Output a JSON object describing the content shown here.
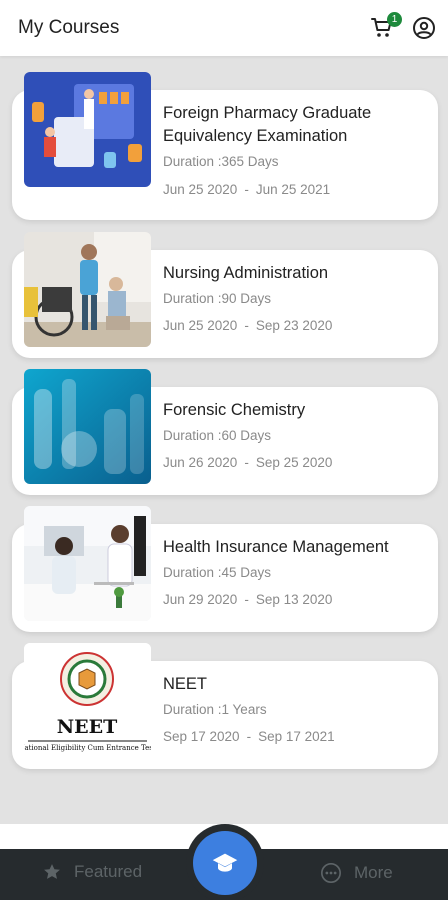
{
  "header": {
    "title": "My Courses",
    "cart_count": "1"
  },
  "courses": [
    {
      "title": "Foreign Pharmacy Graduate Equivalency Examination",
      "duration": "Duration :365 Days",
      "start": "Jun 25 2020",
      "end": "Jun 25 2021",
      "sep": "-"
    },
    {
      "title": " Nursing Administration",
      "duration": "Duration :90 Days",
      "start": "Jun 25 2020",
      "end": "Sep 23 2020",
      "sep": "-"
    },
    {
      "title": "Forensic Chemistry",
      "duration": "Duration :60 Days",
      "start": "Jun 26 2020",
      "end": "Sep 25 2020",
      "sep": "-"
    },
    {
      "title": "Health Insurance Management",
      "duration": "Duration :45 Days",
      "start": "Jun 29 2020",
      "end": "Sep 13 2020",
      "sep": "-"
    },
    {
      "title": "NEET",
      "duration": "Duration :1 Years",
      "start": "Sep 17 2020",
      "end": "Sep 17 2021",
      "sep": "-",
      "logo_text": "NEET",
      "logo_caption": "National Eligibility Cum Entrance Test"
    }
  ],
  "nav": {
    "featured": "Featured",
    "more": "More"
  },
  "colors": {
    "accent": "#3d7fe0",
    "badge": "#1e8a3c",
    "navbar": "#262b2e"
  }
}
